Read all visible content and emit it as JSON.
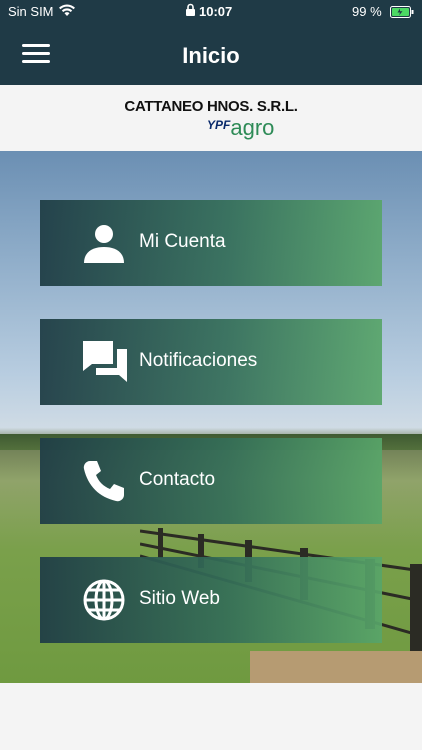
{
  "status": {
    "carrier": "Sin SIM",
    "time": "10:07",
    "battery": "99 %"
  },
  "header": {
    "title": "Inicio"
  },
  "brand": {
    "company": "CATTANEO HNOS. S.R.L.",
    "logo_ypf": "YPF",
    "logo_agro": "agro"
  },
  "menu": {
    "items": [
      {
        "label": "Mi Cuenta",
        "icon": "user-icon"
      },
      {
        "label": "Notificaciones",
        "icon": "chat-icon"
      },
      {
        "label": "Contacto",
        "icon": "phone-icon"
      },
      {
        "label": "Sitio Web",
        "icon": "globe-icon"
      }
    ]
  },
  "colors": {
    "header": "#1f3a46",
    "tile_start": "#203e46",
    "tile_end": "#58a569",
    "agro_green": "#2e8b57"
  }
}
